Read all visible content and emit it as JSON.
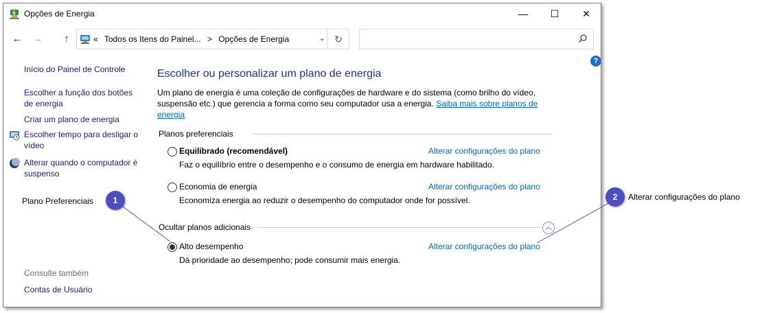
{
  "window": {
    "title": "Opções de Energia",
    "minimize_label": "—",
    "maximize_label": "☐",
    "close_label": "✕"
  },
  "toolbar": {
    "back_label": "←",
    "forward_label": "→",
    "up_label": "↑",
    "breadcrumb_sep": "«",
    "breadcrumb_1": "Todos os Itens do Painel...",
    "breadcrumb_arrow": ">",
    "breadcrumb_2": "Opções de Energia",
    "dropdown_label": "⌄",
    "refresh_label": "↻",
    "search_value": "",
    "search_placeholder": ""
  },
  "help": {
    "label": "?"
  },
  "sidebar": {
    "home": "Início do Painel de Controle",
    "items": [
      {
        "label": "Escolher a função dos botões de energia",
        "icon": "none"
      },
      {
        "label": "Criar um plano de energia",
        "icon": "none"
      },
      {
        "label": "Escolher tempo para desligar o vídeo",
        "icon": "monitor-clock-icon"
      },
      {
        "label": "Alterar quando o computador é suspenso",
        "icon": "moon-icon"
      }
    ],
    "see_also_title": "Consulte também",
    "see_also_items": [
      "Contas de Usuário"
    ]
  },
  "main": {
    "title": "Escolher ou personalizar um plano de energia",
    "description": "Um plano de energia é uma coleção de configurações de hardware e do sistema (como brilho do vídeo, suspensão etc.) que gerencia a forma como seu computador usa a energia.",
    "learn_more_link": "Saiba mais sobre planos de energia",
    "preferred_header": "Planos preferenciais",
    "hidden_header": "Ocultar planos adicionais",
    "plans": [
      {
        "name": "Equilibrado (recomendável)",
        "desc": "Faz o equilíbrio entre o desempenho e o consumo de energia em hardware habilitado.",
        "link": "Alterar configurações do plano",
        "selected": false
      },
      {
        "name": "Economia de energia",
        "desc": "Economiza energia ao reduzir o desempenho do computador onde for possível.",
        "link": "Alterar configurações do plano",
        "selected": false
      },
      {
        "name": "Alto desempenho",
        "desc": "Dá prioridade ao desempenho; pode consumir mais energia.",
        "link": "Alterar configurações do plano",
        "selected": true
      }
    ]
  },
  "callouts": [
    {
      "number": "1",
      "text": "Plano  Preferenciais"
    },
    {
      "number": "2",
      "text": "Alterar configurações  do plano"
    }
  ],
  "colors": {
    "accent": "#0066cc",
    "title": "#1e3287",
    "callout": "#4b4fc2"
  }
}
